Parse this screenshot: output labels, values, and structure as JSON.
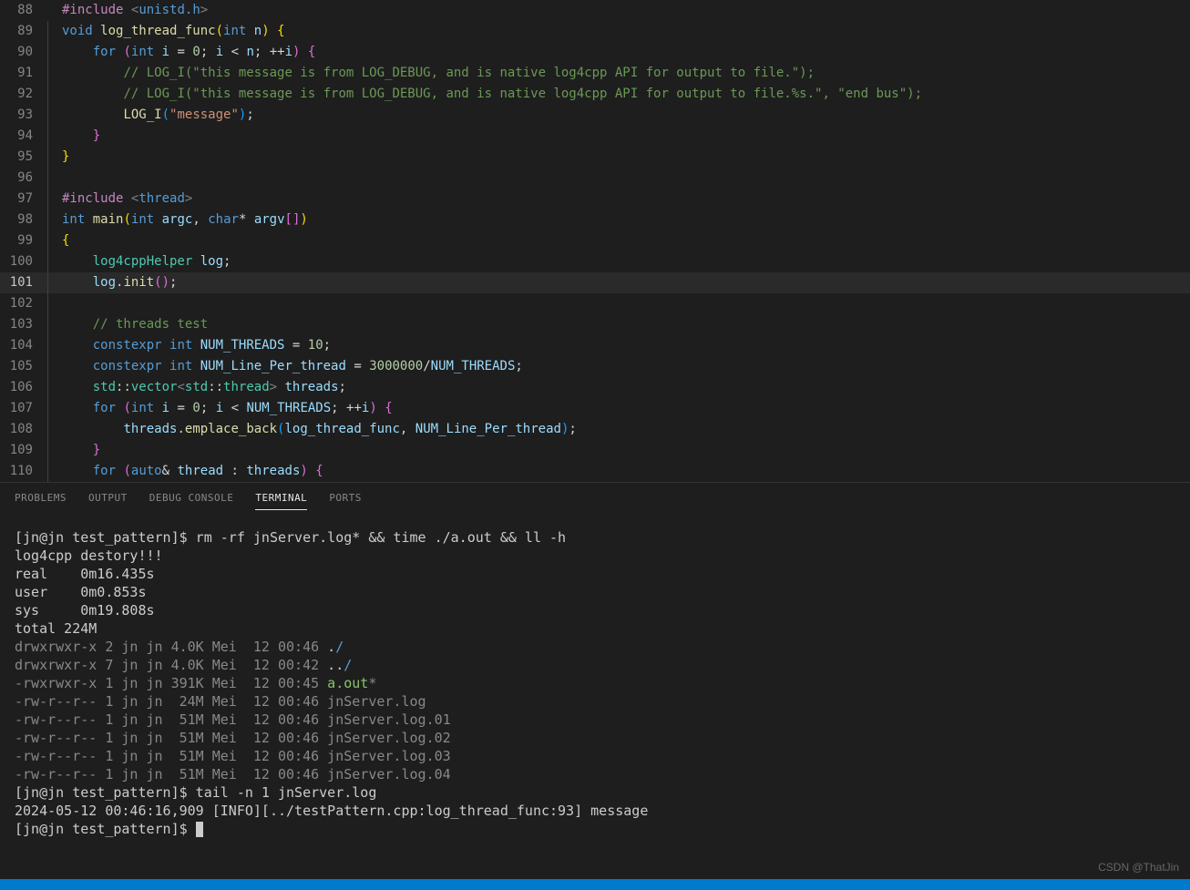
{
  "code_lines": [
    {
      "num": "88",
      "html": "<span class='preproc'>#include</span> <span class='angle'>&lt;</span><span class='preproc-val'>unistd.h</span><span class='angle'>&gt;</span>",
      "indent": 0
    },
    {
      "num": "89",
      "html": "<span class='keyword'>void</span> <span class='function'>log_thread_func</span><span class='brace2'>(</span><span class='type'>int</span> <span class='variable'>n</span><span class='brace2'>)</span> <span class='brace2'>{</span>",
      "indent": 0
    },
    {
      "num": "90",
      "html": "    <span class='keyword'>for</span> <span class='brace'>(</span><span class='type'>int</span> <span class='variable'>i</span> <span class='operator'>=</span> <span class='number'>0</span><span class='punct'>;</span> <span class='variable'>i</span> <span class='operator'>&lt;</span> <span class='variable'>n</span><span class='punct'>;</span> <span class='operator'>++</span><span class='variable'>i</span><span class='brace'>)</span> <span class='brace'>{</span>",
      "indent": 1
    },
    {
      "num": "91",
      "html": "        <span class='comment'>// LOG_I(\"this message is from LOG_DEBUG, and is native log4cpp API for output to file.\");</span>",
      "indent": 2
    },
    {
      "num": "92",
      "html": "        <span class='comment'>// LOG_I(\"this message is from LOG_DEBUG, and is native log4cpp API for output to file.%s.\", \"end bus\");</span>",
      "indent": 2
    },
    {
      "num": "93",
      "html": "        <span class='function'>LOG_I</span><span class='brace3'>(</span><span class='string'>\"message\"</span><span class='brace3'>)</span><span class='punct'>;</span>",
      "indent": 2
    },
    {
      "num": "94",
      "html": "    <span class='brace'>}</span>",
      "indent": 1
    },
    {
      "num": "95",
      "html": "<span class='brace2'>}</span>",
      "indent": 0
    },
    {
      "num": "96",
      "html": "",
      "indent": 0
    },
    {
      "num": "97",
      "html": "<span class='preproc'>#include</span> <span class='angle'>&lt;</span><span class='preproc-val'>thread</span><span class='angle'>&gt;</span>",
      "indent": 0
    },
    {
      "num": "98",
      "html": "<span class='keyword'>int</span> <span class='function'>main</span><span class='brace2'>(</span><span class='type'>int</span> <span class='variable'>argc</span><span class='punct'>,</span> <span class='type'>char</span><span class='operator'>*</span> <span class='variable'>argv</span><span class='brace'>[</span><span class='brace'>]</span><span class='brace2'>)</span>",
      "indent": 0
    },
    {
      "num": "99",
      "html": "<span class='brace2'>{</span>",
      "indent": 0
    },
    {
      "num": "100",
      "html": "    <span class='class'>log4cppHelper</span> <span class='variable'>log</span><span class='punct'>;</span>",
      "indent": 1
    },
    {
      "num": "101",
      "html": "    <span class='variable'>log</span><span class='punct'>.</span><span class='function'>init</span><span class='brace'>(</span><span class='brace'>)</span><span class='punct'>;</span>",
      "indent": 1,
      "active": true
    },
    {
      "num": "102",
      "html": "",
      "indent": 1
    },
    {
      "num": "103",
      "html": "    <span class='comment'>// threads test</span>",
      "indent": 1
    },
    {
      "num": "104",
      "html": "    <span class='keyword'>constexpr</span> <span class='type'>int</span> <span class='variable'>NUM_THREADS</span> <span class='operator'>=</span> <span class='number'>10</span><span class='punct'>;</span>",
      "indent": 1
    },
    {
      "num": "105",
      "html": "    <span class='keyword'>constexpr</span> <span class='type'>int</span> <span class='variable'>NUM_Line_Per_thread</span> <span class='operator'>=</span> <span class='number'>3000000</span><span class='operator'>/</span><span class='variable'>NUM_THREADS</span><span class='punct'>;</span>",
      "indent": 1
    },
    {
      "num": "106",
      "html": "    <span class='class'>std</span><span class='punct'>::</span><span class='class'>vector</span><span class='angle'>&lt;</span><span class='class'>std</span><span class='punct'>::</span><span class='class'>thread</span><span class='angle'>&gt;</span> <span class='variable'>threads</span><span class='punct'>;</span>",
      "indent": 1
    },
    {
      "num": "107",
      "html": "    <span class='keyword'>for</span> <span class='brace'>(</span><span class='type'>int</span> <span class='variable'>i</span> <span class='operator'>=</span> <span class='number'>0</span><span class='punct'>;</span> <span class='variable'>i</span> <span class='operator'>&lt;</span> <span class='variable'>NUM_THREADS</span><span class='punct'>;</span> <span class='operator'>++</span><span class='variable'>i</span><span class='brace'>)</span> <span class='brace'>{</span>",
      "indent": 1
    },
    {
      "num": "108",
      "html": "        <span class='variable'>threads</span><span class='punct'>.</span><span class='function'>emplace_back</span><span class='brace3'>(</span><span class='variable'>log_thread_func</span><span class='punct'>,</span> <span class='variable'>NUM_Line_Per_thread</span><span class='brace3'>)</span><span class='punct'>;</span>",
      "indent": 2
    },
    {
      "num": "109",
      "html": "    <span class='brace'>}</span>",
      "indent": 1
    },
    {
      "num": "110",
      "html": "    <span class='keyword'>for</span> <span class='brace'>(</span><span class='keyword'>auto</span><span class='operator'>&amp;</span> <span class='variable'>thread</span> <span class='operator'>:</span> <span class='variable'>threads</span><span class='brace'>)</span> <span class='brace'>{</span>",
      "indent": 1
    }
  ],
  "panel": {
    "tabs": [
      {
        "label": "PROBLEMS",
        "active": false
      },
      {
        "label": "OUTPUT",
        "active": false
      },
      {
        "label": "DEBUG CONSOLE",
        "active": false
      },
      {
        "label": "TERMINAL",
        "active": true
      },
      {
        "label": "PORTS",
        "active": false
      }
    ]
  },
  "terminal": {
    "lines": [
      {
        "segments": [
          {
            "t": "[jn@jn test_pattern]$ rm -rf jnServer.log* && time ./a.out && ll -h"
          }
        ]
      },
      {
        "segments": [
          {
            "t": "log4cpp destory!!!"
          }
        ]
      },
      {
        "segments": [
          {
            "t": ""
          }
        ]
      },
      {
        "segments": [
          {
            "t": "real    0m16.435s"
          }
        ]
      },
      {
        "segments": [
          {
            "t": "user    0m0.853s"
          }
        ]
      },
      {
        "segments": [
          {
            "t": "sys     0m19.808s"
          }
        ]
      },
      {
        "segments": [
          {
            "t": "total 224M"
          }
        ]
      },
      {
        "segments": [
          {
            "t": "drwxrwxr-x 2 jn jn 4.0K Mei  12 00:46 ",
            "c": "term-dark"
          },
          {
            "t": "."
          },
          {
            "t": "/",
            "c": "term-blue"
          }
        ]
      },
      {
        "segments": [
          {
            "t": "drwxrwxr-x 7 jn jn 4.0K Mei  12 00:42 ",
            "c": "term-dark"
          },
          {
            "t": ".."
          },
          {
            "t": "/",
            "c": "term-blue"
          }
        ]
      },
      {
        "segments": [
          {
            "t": "-rwxrwxr-x 1 jn jn 391K Mei  12 00:45 ",
            "c": "term-dark"
          },
          {
            "t": "a.out",
            "c": "term-green"
          },
          {
            "t": "*",
            "c": "term-dark"
          }
        ]
      },
      {
        "segments": [
          {
            "t": "-rw-r--r-- 1 jn jn  24M Mei  12 00:46 jnServer.log",
            "c": "term-dark"
          }
        ]
      },
      {
        "segments": [
          {
            "t": "-rw-r--r-- 1 jn jn  51M Mei  12 00:46 jnServer.log.01",
            "c": "term-dark"
          }
        ]
      },
      {
        "segments": [
          {
            "t": "-rw-r--r-- 1 jn jn  51M Mei  12 00:46 jnServer.log.02",
            "c": "term-dark"
          }
        ]
      },
      {
        "segments": [
          {
            "t": "-rw-r--r-- 1 jn jn  51M Mei  12 00:46 jnServer.log.03",
            "c": "term-dark"
          }
        ]
      },
      {
        "segments": [
          {
            "t": "-rw-r--r-- 1 jn jn  51M Mei  12 00:46 jnServer.log.04",
            "c": "term-dark"
          }
        ]
      },
      {
        "segments": [
          {
            "t": "[jn@jn test_pattern]$ tail -n 1 jnServer.log"
          }
        ]
      },
      {
        "segments": [
          {
            "t": "2024-05-12 00:46:16,909 [INFO][../testPattern.cpp:log_thread_func:93] message"
          }
        ]
      },
      {
        "segments": [
          {
            "t": "[jn@jn test_pattern]$ "
          }
        ],
        "cursor": true
      }
    ]
  },
  "watermark": "CSDN @ThatJin"
}
